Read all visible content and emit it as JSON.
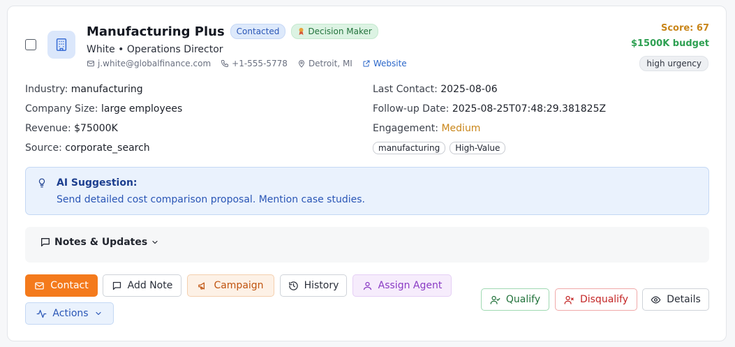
{
  "lead": {
    "company": "Manufacturing Plus",
    "status_badge": "Contacted",
    "role_badge": "Decision Maker",
    "contact_line": "White • Operations Director",
    "email": "j.white@globalfinance.com",
    "phone": "+1-555-5778",
    "location": "Detroit, MI",
    "website_label": "Website",
    "score": "Score: 67",
    "budget": "$1500K budget",
    "urgency": "high urgency"
  },
  "details": {
    "industry_label": "Industry:",
    "industry": "manufacturing",
    "size_label": "Company Size:",
    "size": "large employees",
    "revenue_label": "Revenue:",
    "revenue": "$75000K",
    "source_label": "Source:",
    "source": "corporate_search",
    "last_contact_label": "Last Contact:",
    "last_contact": "2025-08-06",
    "followup_label": "Follow-up Date:",
    "followup": "2025-08-25T07:48:29.381825Z",
    "engagement_label": "Engagement:",
    "engagement": "Medium",
    "tags": [
      "manufacturing",
      "High-Value"
    ]
  },
  "ai": {
    "title": "AI Suggestion:",
    "text": "Send detailed cost comparison proposal. Mention case studies."
  },
  "notes": {
    "heading": "Notes & Updates"
  },
  "actions": {
    "contact": "Contact",
    "add_note": "Add Note",
    "campaign": "Campaign",
    "history": "History",
    "assign_agent": "Assign Agent",
    "actions": "Actions",
    "qualify": "Qualify",
    "disqualify": "Disqualify",
    "details": "Details"
  },
  "colors": {
    "accent_orange": "#f47a1c",
    "score_orange": "#c9861a",
    "budget_green": "#2ea052",
    "ai_blue": "#2a56b6"
  },
  "icons": {
    "avatar": "building-icon",
    "email": "mail-icon",
    "phone": "phone-icon",
    "location": "map-pin-icon",
    "website": "external-link-icon",
    "ai": "lightbulb-icon",
    "notes": "message-square-icon",
    "role_badge": "award-icon"
  }
}
